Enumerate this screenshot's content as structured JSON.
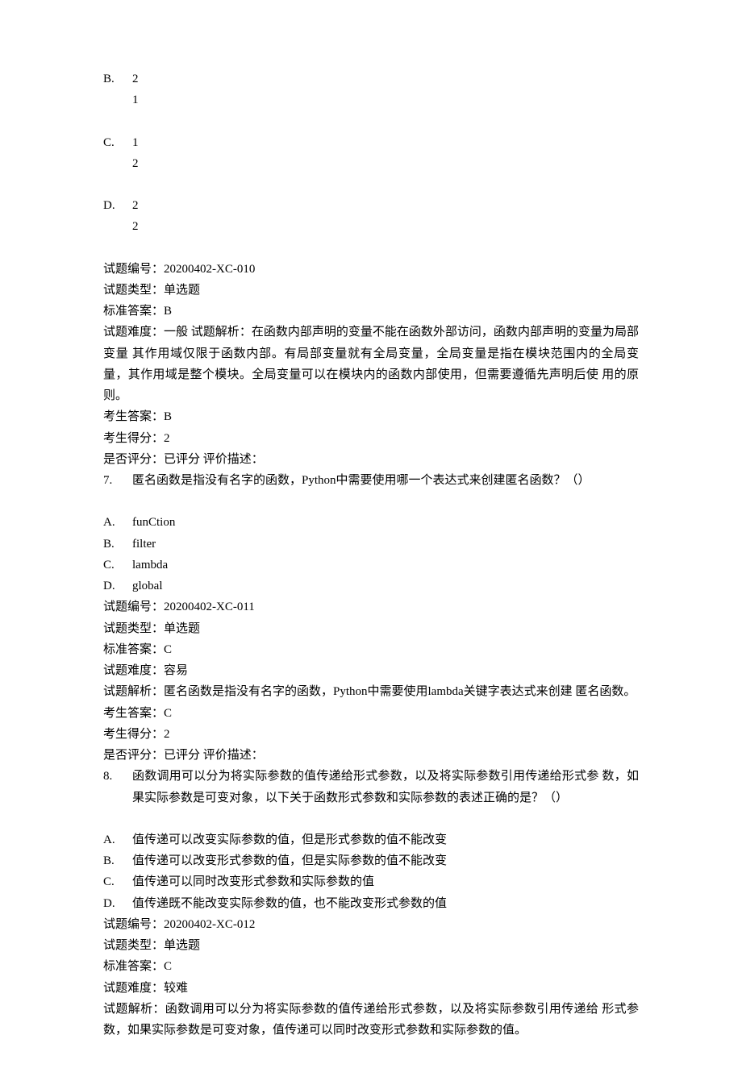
{
  "q6": {
    "options": {
      "B": {
        "letter": "B.",
        "l1": "2",
        "l2": "1"
      },
      "C": {
        "letter": "C.",
        "l1": "1",
        "l2": "2"
      },
      "D": {
        "letter": "D.",
        "l1": "2",
        "l2": "2"
      }
    },
    "id": "试题编号：20200402-XC-010",
    "type": "试题类型：单选题",
    "key": "标准答案：B",
    "diff_analysis": "试题难度：一般 试题解析：在函数内部声明的变量不能在函数外部访问，函数内部声明的变量为局部变量 其作用域仅限于函数内部。有局部变量就有全局变量，全局变量是指在模块范围内的全局变 量，其作用域是整个模块。全局变量可以在模块内的函数内部使用，但需要遵循先声明后使 用的原则。",
    "ans": "考生答案：B",
    "score": "考生得分：2",
    "graded": "是否评分：已评分 评价描述："
  },
  "q7": {
    "num": "7.",
    "stem": "匿名函数是指没有名字的函数，Python中需要使用哪一个表达式来创建匿名函数？（）",
    "A": {
      "letter": "A.",
      "text": "funCtion"
    },
    "B": {
      "letter": "B.",
      "text": "filter"
    },
    "C": {
      "letter": "C.",
      "text": "lambda"
    },
    "D": {
      "letter": "D.",
      "text": "global"
    },
    "id": "试题编号：20200402-XC-011",
    "type": "试题类型：单选题",
    "key": "标准答案：C",
    "diff": "试题难度：容易",
    "analysis": "试题解析：匿名函数是指没有名字的函数，Python中需要使用lambda关键字表达式来创建 匿名函数。",
    "ans": "考生答案：C",
    "score": "考生得分：2",
    "graded": "是否评分：已评分 评价描述："
  },
  "q8": {
    "num": "8.",
    "stem": "函数调用可以分为将实际参数的值传递给形式参数，以及将实际参数引用传递给形式参 数，如果实际参数是可变对象，以下关于函数形式参数和实际参数的表述正确的是？（）",
    "A": {
      "letter": "A.",
      "text": "值传递可以改变实际参数的值，但是形式参数的值不能改变"
    },
    "B": {
      "letter": "B.",
      "text": "值传递可以改变形式参数的值，但是实际参数的值不能改变"
    },
    "C": {
      "letter": "C.",
      "text": "值传递可以同时改变形式参数和实际参数的值"
    },
    "D": {
      "letter": "D.",
      "text": "值传递既不能改变实际参数的值，也不能改变形式参数的值"
    },
    "id": "试题编号：20200402-XC-012",
    "type": "试题类型：单选题",
    "key": "标准答案：C",
    "diff": "试题难度：较难",
    "analysis": "试题解析：函数调用可以分为将实际参数的值传递给形式参数，以及将实际参数引用传递给 形式参数，如果实际参数是可变对象，值传递可以同时改变形式参数和实际参数的值。"
  }
}
